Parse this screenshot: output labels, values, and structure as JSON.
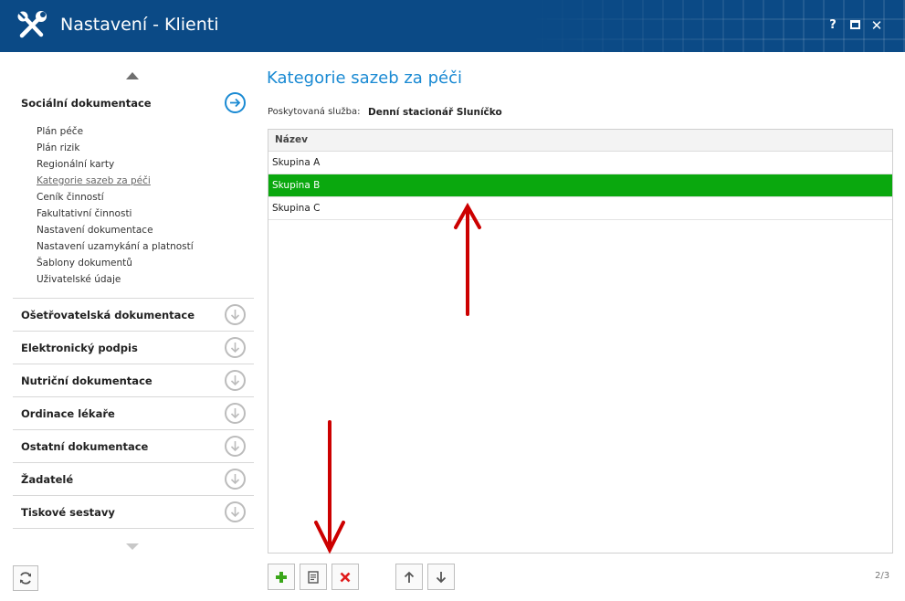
{
  "window": {
    "title": "Nastavení - Klienti",
    "help": "?",
    "close": "✕"
  },
  "sidebar": {
    "active_section": {
      "label": "Sociální dokumentace",
      "items": [
        {
          "label": "Plán péče"
        },
        {
          "label": "Plán rizik"
        },
        {
          "label": "Regionální karty"
        },
        {
          "label": "Kategorie sazeb za péči",
          "current": true
        },
        {
          "label": "Ceník činností"
        },
        {
          "label": "Fakultativní činnosti"
        },
        {
          "label": "Nastavení dokumentace"
        },
        {
          "label": "Nastavení uzamykání a platností"
        },
        {
          "label": "Šablony dokumentů"
        },
        {
          "label": "Uživatelské údaje"
        }
      ]
    },
    "sections": [
      {
        "label": "Ošetřovatelská dokumentace"
      },
      {
        "label": "Elektronický podpis"
      },
      {
        "label": "Nutriční dokumentace"
      },
      {
        "label": "Ordinace lékaře"
      },
      {
        "label": "Ostatní dokumentace"
      },
      {
        "label": "Žadatelé"
      },
      {
        "label": "Tiskové sestavy"
      }
    ]
  },
  "main": {
    "title": "Kategorie sazeb za péči",
    "service_label": "Poskytovaná služba:",
    "service_value": "Denní stacionář Sluníčko",
    "grid": {
      "column_header": "Název",
      "rows": [
        {
          "name": "Skupina A"
        },
        {
          "name": "Skupina B",
          "selected": true
        },
        {
          "name": "Skupina C"
        }
      ]
    },
    "page_info": "2/3"
  },
  "colors": {
    "titlebar": "#0b4a86",
    "accent": "#1a8ad3",
    "selected_row": "#0aa80e",
    "annotation_arrow": "#cc0000"
  }
}
